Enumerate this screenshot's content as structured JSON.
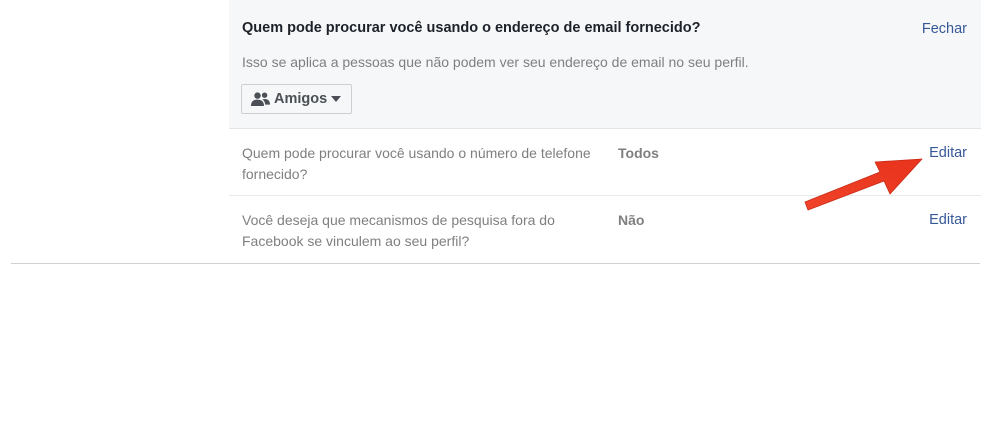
{
  "expanded": {
    "question": "Quem pode procurar você usando o endereço de email fornecido?",
    "close_label": "Fechar",
    "description": "Isso se aplica a pessoas que não podem ver seu endereço de email no seu perfil.",
    "audience": {
      "icon": "friends-icon",
      "selected": "Amigos"
    }
  },
  "rows": [
    {
      "question": "Quem pode procurar você usando o número de telefone fornecido?",
      "value": "Todos",
      "edit_label": "Editar"
    },
    {
      "question": "Você deseja que mecanismos de pesquisa fora do Facebook se vinculem ao seu perfil?",
      "value": "Não",
      "edit_label": "Editar"
    }
  ],
  "annotation": {
    "arrow_color": "#f0442a",
    "points_to": "Editar"
  },
  "colors": {
    "link": "#365899",
    "muted_text": "#7f7f7f",
    "section_bg": "#f6f7f9"
  }
}
